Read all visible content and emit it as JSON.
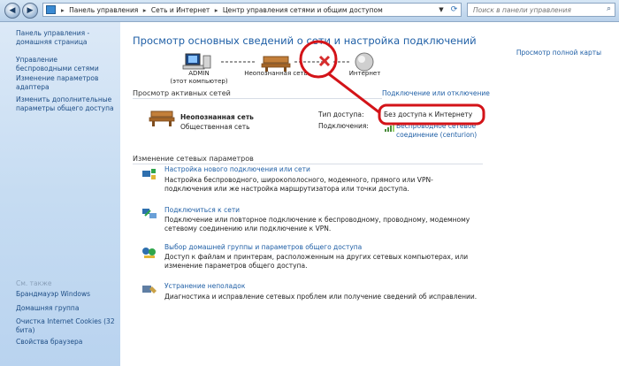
{
  "address_bar": {
    "crumbs": [
      "Панель управления",
      "Сеть и Интернет",
      "Центр управления сетями и общим доступом"
    ],
    "search_placeholder": "Поиск в панели управления"
  },
  "sidebar": {
    "links": [
      "Панель управления - домашняя страница",
      "Управление беспроводными сетями",
      "Изменение параметров адаптера",
      "Изменить дополнительные параметры общего доступа"
    ],
    "see_also_title": "См. также",
    "see_also": [
      "Брандмауэр Windows",
      "Домашняя группа",
      "Очистка Internet Cookies (32 бита)",
      "Свойства браузера"
    ]
  },
  "main": {
    "title": "Просмотр основных сведений о сети и настройка подключений",
    "full_map": "Просмотр полной карты",
    "network_map": {
      "computer": "ADMIN",
      "computer_sub": "(этот компьютер)",
      "network": "Неопознанная сеть",
      "internet": "Интернет"
    },
    "active_networks_title": "Просмотр активных сетей",
    "connect_disconnect": "Подключение или отключение",
    "active_network": {
      "name": "Неопознанная сеть",
      "type": "Общественная сеть",
      "access_label": "Тип доступа:",
      "access_value": "Без доступа к Интернету",
      "connections_label": "Подключения:",
      "connection_value": "Беспроводное сетевое соединение (centurion)"
    },
    "change_settings_title": "Изменение сетевых параметров",
    "tasks": [
      {
        "title": "Настройка нового подключения или сети",
        "desc": "Настройка беспроводного, широкополосного, модемного, прямого или VPN-подключения или же настройка маршрутизатора или точки доступа."
      },
      {
        "title": "Подключиться к сети",
        "desc": "Подключение или повторное подключение к беспроводному, проводному, модемному сетевому соединению или подключение к VPN."
      },
      {
        "title": "Выбор домашней группы и параметров общего доступа",
        "desc": "Доступ к файлам и принтерам, расположенным на других сетевых компьютерах, или изменение параметров общего доступа."
      },
      {
        "title": "Устранение неполадок",
        "desc": "Диагностика и исправление сетевых проблем или получение сведений об исправлении."
      }
    ]
  },
  "colors": {
    "link": "#1f5fa6",
    "annotation": "#d31318",
    "sidebar": "#c6dcf2"
  }
}
